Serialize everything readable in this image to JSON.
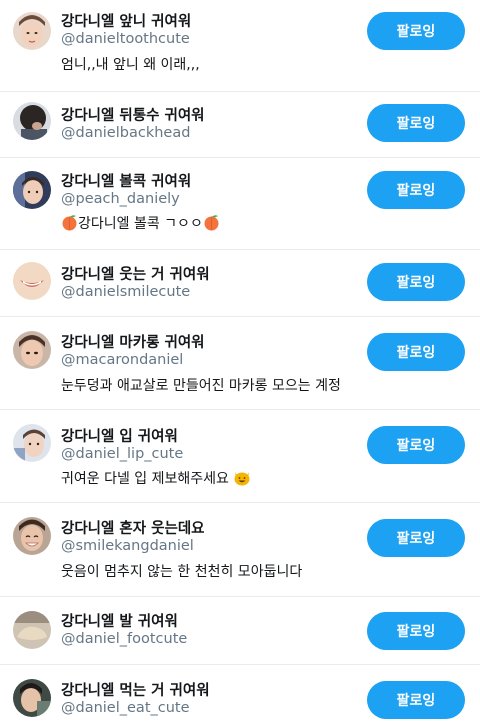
{
  "accent_color": "#1da1f2",
  "follow_label": "팔로잉",
  "accounts": [
    {
      "name": "강다니엘 앞니 귀여워",
      "handle": "@danieltoothcute",
      "bio": "엄니,,내 앞니 왜 이래,,,"
    },
    {
      "name": "강다니엘 뒤통수 귀여워",
      "handle": "@danielbackhead",
      "bio": ""
    },
    {
      "name": "강다니엘 볼콕 귀여워",
      "handle": "@peach_daniely",
      "bio_prefix_emoji": "peach-emoji",
      "bio": "강다니엘 볼콕 ㄱㅇㅇ",
      "bio_suffix_emoji": "peach-emoji"
    },
    {
      "name": "강다니엘 웃는 거 귀여워",
      "handle": "@danielsmilecute",
      "bio": ""
    },
    {
      "name": "강다니엘 마카롱 귀여워",
      "handle": "@macarondaniel",
      "bio": "눈두덩과 애교살로 만들어진 마카롱 모으는 계정"
    },
    {
      "name": "강다니엘 입 귀여워",
      "handle": "@daniel_lip_cute",
      "bio": "귀여운 다넬 입 제보해주세요",
      "bio_suffix_emoji": "grinning-cat-emoji"
    },
    {
      "name": "강다니엘 혼자 웃는데요",
      "handle": "@smilekangdaniel",
      "bio": "웃음이 멈추지 않는 한 천천히 모아둡니다"
    },
    {
      "name": "강다니엘 발 귀여워",
      "handle": "@daniel_footcute",
      "bio": ""
    },
    {
      "name": "강다니엘 먹는 거 귀여워",
      "handle": "@daniel_eat_cute",
      "bio": ""
    }
  ]
}
